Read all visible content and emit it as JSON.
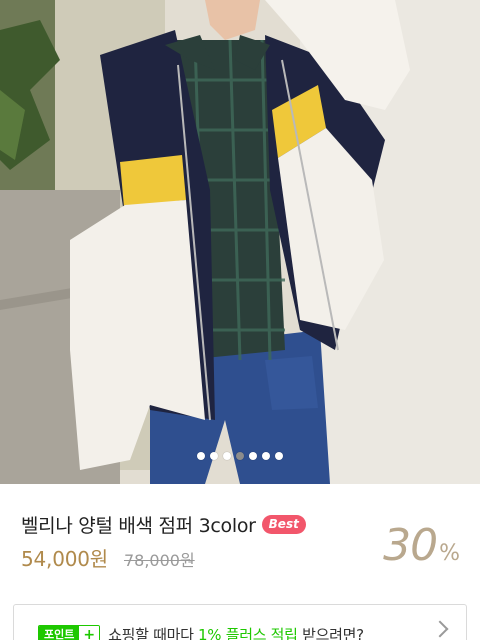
{
  "gallery": {
    "image_name": "product-photo",
    "slide_count": 7,
    "active_slide": 3
  },
  "product": {
    "title": "벨리나 양털 배색 점퍼 3color",
    "badge": "Best",
    "price": "54,000원",
    "original_price": "78,000원",
    "discount_value": "30",
    "discount_unit": "%"
  },
  "points_banner": {
    "badge_label": "포인트",
    "badge_plus": "+",
    "text_before": "쇼핑할 때마다 ",
    "text_highlight": "1% 플러스 적립",
    "text_after": " 받으려면?",
    "icon": "chevron-right-icon"
  },
  "colors": {
    "price": "#b08a4c",
    "discount": "#b9a88e",
    "badge": "#f2566b",
    "points_green": "#1ec800"
  }
}
